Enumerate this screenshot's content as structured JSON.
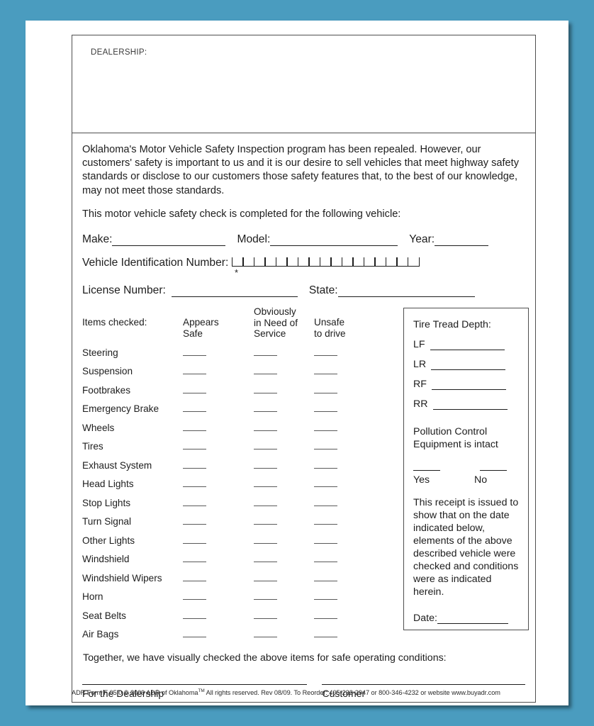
{
  "document": {
    "dealership_label": "DEALERSHIP:",
    "intro_paragraph": "Oklahoma's Motor Vehicle Safety Inspection program has been repealed.  However, our customers' safety is important to us and it is our desire to sell vehicles that meet highway safety standards or disclose to our customers those safety features that, to the best of our knowledge, may not meet those standards.",
    "check_statement": "This motor vehicle safety check is completed for the following vehicle:",
    "vehicle_fields": {
      "make_label": "Make:",
      "model_label": "Model:",
      "year_label": "Year:",
      "vin_label": "Vehicle Identification Number:",
      "vin_cell_count": 17,
      "vin_asterisk": "*",
      "license_label": "License Number:",
      "state_label": "State:"
    },
    "checklist": {
      "items_label": "Items checked:",
      "columns": [
        {
          "line1": "Appears",
          "line2": "Safe",
          "line0": ""
        },
        {
          "line0": "Obviously",
          "line1": "in Need of",
          "line2": "Service"
        },
        {
          "line1": "Unsafe",
          "line2": "to drive",
          "line0": ""
        }
      ],
      "items": [
        "Steering",
        "Suspension",
        "Footbrakes",
        "Emergency Brake",
        "Wheels",
        "Tires",
        "Exhaust System",
        "Head Lights",
        "Stop Lights",
        "Turn Signal",
        "Other Lights",
        "Windshield",
        "Windshield Wipers",
        "Horn",
        "Seat Belts",
        "Air Bags"
      ]
    },
    "tire_box": {
      "title": "Tire Tread Depth:",
      "positions": [
        "LF",
        "LR",
        "RF",
        "RR"
      ],
      "pollution_text": "Pollution Control Equipment is intact",
      "yes_label": "Yes",
      "no_label": "No",
      "receipt_text": "This receipt is issued to show that on the date indicated below, elements of the above described vehicle were checked and conditions were as indicated herein.",
      "date_label": "Date:"
    },
    "closing": {
      "together_text": "Together, we have visually checked the above items for safe operating conditions:",
      "dealership_sig_label": "For the Dealership",
      "customer_sig_label": "Customer"
    },
    "footer": {
      "part1": "ADR Form F 05.0 © 2009 ADR of Oklahoma",
      "trademark": "TM",
      "part2": "  All rights reserved. Rev 08/09.  To Reorder: 405-232-2947 or 800-346-4232 or website www.buyadr.com"
    }
  },
  "colors": {
    "background": "#4a9cbf",
    "page": "#ffffff",
    "rule": "#1d1d1d",
    "box_border": "#4f4f4f"
  }
}
